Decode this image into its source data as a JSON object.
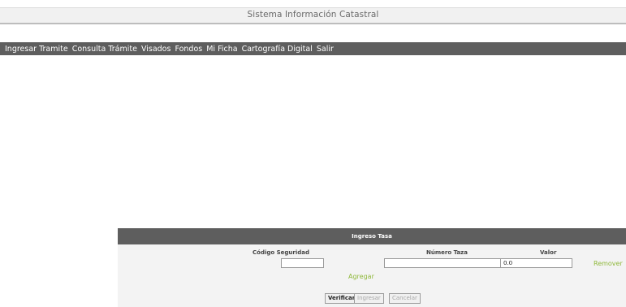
{
  "app": {
    "title": "Sistema Información Catastral"
  },
  "menu": {
    "items": [
      {
        "label": "Ingresar Tramite"
      },
      {
        "label": "Consulta Trámite"
      },
      {
        "label": "Visados"
      },
      {
        "label": "Fondos"
      },
      {
        "label": "Mi Ficha"
      },
      {
        "label": "Cartografía Digital"
      },
      {
        "label": "Salir"
      }
    ]
  },
  "panel": {
    "title": "Ingreso Tasa",
    "columns": {
      "codigo": "Código Seguridad",
      "numero": "Número Taza",
      "valor": "Valor"
    },
    "row": {
      "codigo_value": "",
      "numero_value": "",
      "valor_value": "0.0",
      "remove_label": "Remover"
    },
    "add_label": "Agregar",
    "buttons": {
      "verify": "Verificar",
      "submit": "Ingresar",
      "cancel": "Cancelar"
    }
  }
}
